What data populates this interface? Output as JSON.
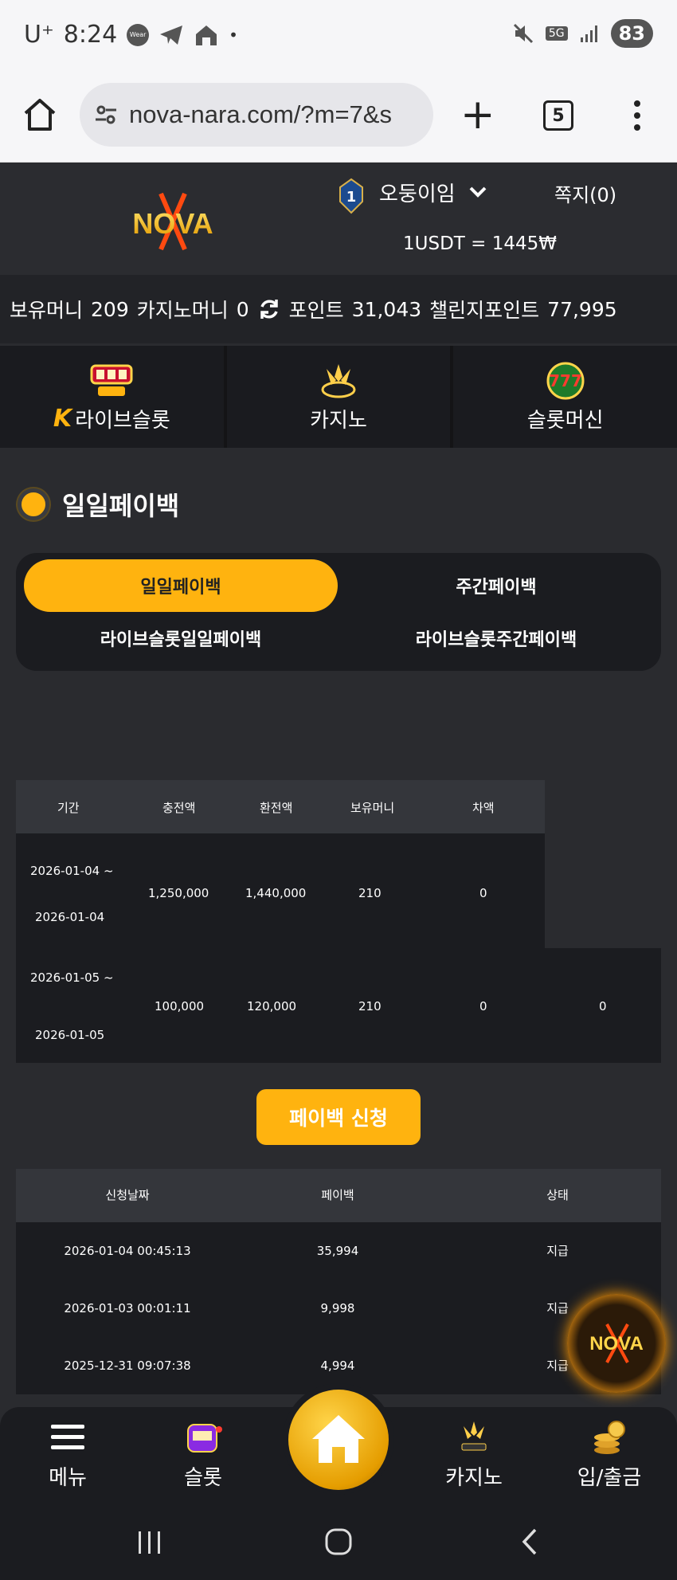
{
  "status_bar": {
    "carrier": "U⁺",
    "time": "8:24",
    "wear_label": "Wear",
    "network": "5G",
    "battery": "83"
  },
  "browser": {
    "url": "nova-nara.com/?m=7&s",
    "tab_count": "5"
  },
  "header": {
    "username": "오둥이임",
    "messages_label": "쪽지(0)",
    "rank_badge": "1",
    "exchange_rate": "1USDT = 1445₩"
  },
  "balances": {
    "money_label": "보유머니",
    "money_value": "209",
    "casino_label": "카지노머니",
    "casino_value": "0",
    "points_label": "포인트",
    "points_value": "31,043",
    "challenge_label": "챌린지포인트",
    "challenge_value": "77,995"
  },
  "categories": [
    {
      "label": "라이브슬롯",
      "icon": "live-slot-icon"
    },
    {
      "label": "카지노",
      "icon": "k-slot-icon"
    },
    {
      "label": "슬롯머신",
      "icon": "slots-777-icon"
    }
  ],
  "section_title": "일일페이백",
  "sub_tabs": [
    {
      "label": "일일페이백"
    },
    {
      "label": "주간페이백"
    },
    {
      "label": "라이브슬롯일일페이백"
    },
    {
      "label": "라이브슬롯주간페이백"
    }
  ],
  "summary_table": {
    "headers": [
      "기간",
      "충전액",
      "환전액",
      "보유머니",
      "차액"
    ],
    "rows": [
      {
        "period_start": "2026-01-04 ~",
        "period_end": "2026-01-04",
        "deposit": "1,250,000",
        "withdraw": "1,440,000",
        "balance": "210",
        "diff": "0"
      },
      {
        "period_start": "2026-01-05 ~",
        "period_end": "2026-01-05",
        "deposit": "100,000",
        "withdraw": "120,000",
        "balance": "210",
        "diff": "0",
        "extra": "0"
      }
    ]
  },
  "apply_button": "페이백 신청",
  "history_table": {
    "headers": [
      "신청날짜",
      "페이백",
      "상태"
    ],
    "rows": [
      {
        "date": "2026-01-04 00:45:13",
        "amount": "35,994",
        "status": "지급"
      },
      {
        "date": "2026-01-03 00:01:11",
        "amount": "9,998",
        "status": "지급"
      },
      {
        "date": "2025-12-31 09:07:38",
        "amount": "4,994",
        "status": "지급"
      }
    ]
  },
  "bottom_nav": [
    {
      "label": "메뉴"
    },
    {
      "label": "슬롯"
    },
    {
      "label": "카지노"
    },
    {
      "label": "입/출금"
    }
  ],
  "logo_text": "NOVA",
  "colors": {
    "accent": "#ffb30f",
    "bg": "#2a2b2f",
    "panel": "#1b1c20"
  }
}
